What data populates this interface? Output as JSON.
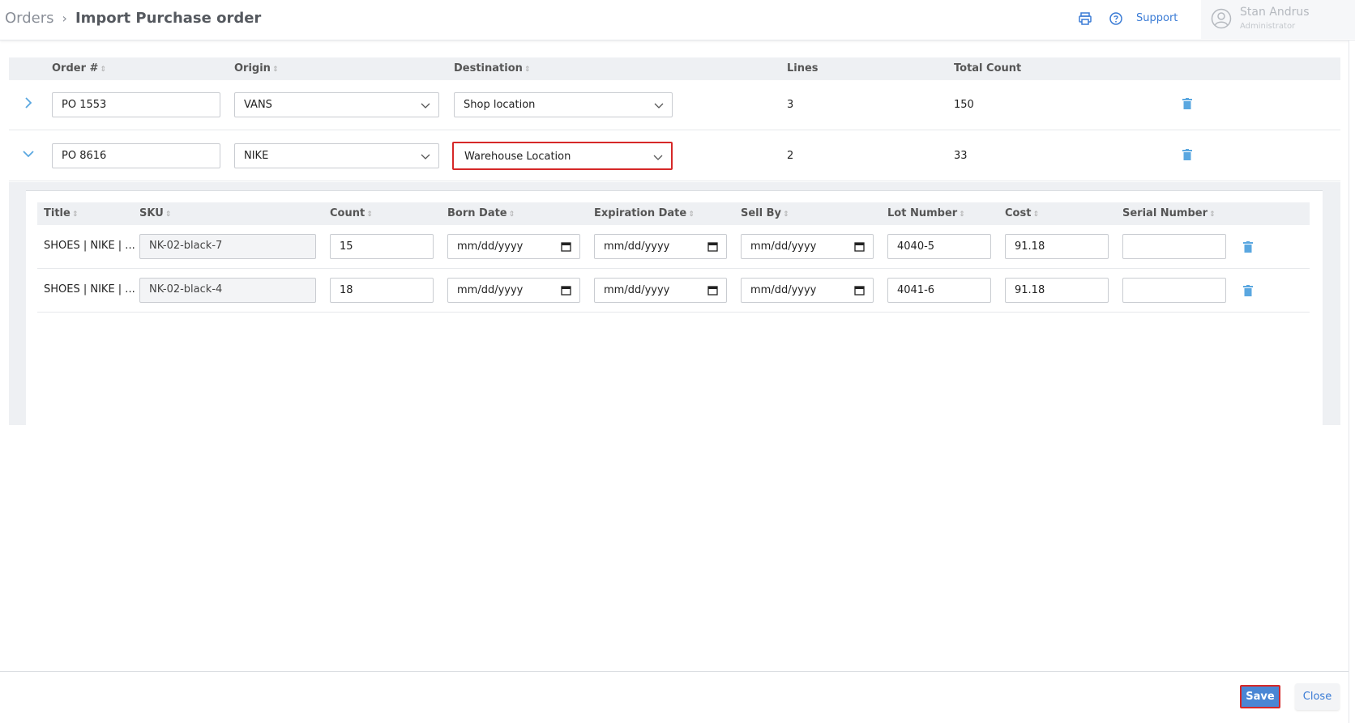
{
  "header": {
    "breadcrumb_parent": "Orders",
    "breadcrumb_current": "Import Purchase order",
    "support_label": "Support",
    "user_name": "Stan Andrus",
    "user_role": "Administrator"
  },
  "orders_table": {
    "columns": [
      "Order #",
      "Origin",
      "Destination",
      "Lines",
      "Total Count"
    ],
    "rows": [
      {
        "order_no": "PO 1553",
        "origin": "VANS",
        "destination": "Shop location",
        "lines": "3",
        "total_count": "150",
        "expanded": false
      },
      {
        "order_no": "PO 8616",
        "origin": "NIKE",
        "destination": "Warehouse Location",
        "lines": "2",
        "total_count": "33",
        "expanded": true
      }
    ]
  },
  "detail_table": {
    "columns": [
      "Title",
      "SKU",
      "Count",
      "Born Date",
      "Expiration Date",
      "Sell By",
      "Lot Number",
      "Cost",
      "Serial Number"
    ],
    "rows": [
      {
        "title": "SHOES | NIKE | ...",
        "sku": "NK-02-black-7",
        "count": "15",
        "born_date": "mm/dd/yyyy",
        "expiration_date": "mm/dd/yyyy",
        "sell_by": "mm/dd/yyyy",
        "lot_number": "4040-5",
        "cost": "91.18",
        "serial_number": ""
      },
      {
        "title": "SHOES | NIKE | ...",
        "sku": "NK-02-black-4",
        "count": "18",
        "born_date": "mm/dd/yyyy",
        "expiration_date": "mm/dd/yyyy",
        "sell_by": "mm/dd/yyyy",
        "lot_number": "4041-6",
        "cost": "91.18",
        "serial_number": ""
      }
    ]
  },
  "footer": {
    "save_label": "Save",
    "close_label": "Close"
  },
  "colors": {
    "accent": "#4a86d4",
    "highlight": "#d62828",
    "icon_blue": "#5aa7e0"
  },
  "icons": [
    "printer-icon",
    "help-icon",
    "user-avatar-icon",
    "chevron-right-icon",
    "chevron-down-icon",
    "trash-icon",
    "calendar-icon",
    "sort-icon"
  ]
}
